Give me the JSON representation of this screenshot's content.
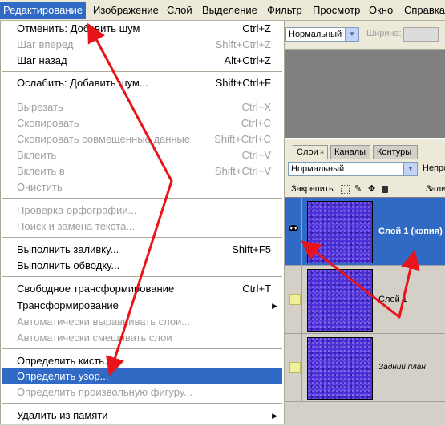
{
  "menubar": {
    "items": [
      "Редактирование",
      "Изображение",
      "Слой",
      "Выделение",
      "Фильтр",
      "Просмотр",
      "Окно",
      "Справка"
    ]
  },
  "options": {
    "blend_mode": "Нормальный",
    "width_label": "Ширина:"
  },
  "edit_menu": {
    "items": [
      {
        "label": "Отменить: Добавить шум",
        "shortcut": "Ctrl+Z"
      },
      {
        "label": "Шаг вперед",
        "shortcut": "Shift+Ctrl+Z"
      },
      {
        "label": "Шаг назад",
        "shortcut": "Alt+Ctrl+Z"
      },
      {
        "label": "Ослабить: Добавить шум...",
        "shortcut": "Shift+Ctrl+F"
      },
      {
        "label": "Вырезать",
        "shortcut": "Ctrl+X"
      },
      {
        "label": "Скопировать",
        "shortcut": "Ctrl+C"
      },
      {
        "label": "Скопировать совмещенные данные",
        "shortcut": "Shift+Ctrl+C"
      },
      {
        "label": "Вклеить",
        "shortcut": "Ctrl+V"
      },
      {
        "label": "Вклеить в",
        "shortcut": "Shift+Ctrl+V"
      },
      {
        "label": "Очистить",
        "shortcut": ""
      },
      {
        "label": "Проверка орфографии...",
        "shortcut": ""
      },
      {
        "label": "Поиск и замена текста...",
        "shortcut": ""
      },
      {
        "label": "Выполнить заливку...",
        "shortcut": "Shift+F5"
      },
      {
        "label": "Выполнить обводку...",
        "shortcut": ""
      },
      {
        "label": "Свободное трансформирование",
        "shortcut": "Ctrl+T"
      },
      {
        "label": "Трансформирование",
        "shortcut": ""
      },
      {
        "label": "Автоматически выравнивать слои...",
        "shortcut": ""
      },
      {
        "label": "Автоматически смешивать слои",
        "shortcut": ""
      },
      {
        "label": "Определить кисть...",
        "shortcut": ""
      },
      {
        "label": "Определить узор...",
        "shortcut": ""
      },
      {
        "label": "Определить произвольную фигуру...",
        "shortcut": ""
      },
      {
        "label": "Удалить из памяти",
        "shortcut": ""
      }
    ]
  },
  "layers_panel": {
    "tabs": [
      "Слои",
      "Каналы",
      "Контуры"
    ],
    "tab_close": "×",
    "blend_mode": "Нормальный",
    "opacity_label": "Непро",
    "lock_label": "Закрепить:",
    "fill_label": "Зали",
    "layers": [
      {
        "name": "Слой 1 (копия)",
        "visible": true,
        "selected": true
      },
      {
        "name": "Слой 1",
        "visible": false,
        "selected": false
      },
      {
        "name": "Задний план",
        "visible": false,
        "selected": false
      }
    ]
  },
  "colors": {
    "selection": "#316ac5",
    "annotation_arrow": "#e8141a",
    "texture": "#4b2ed6"
  }
}
